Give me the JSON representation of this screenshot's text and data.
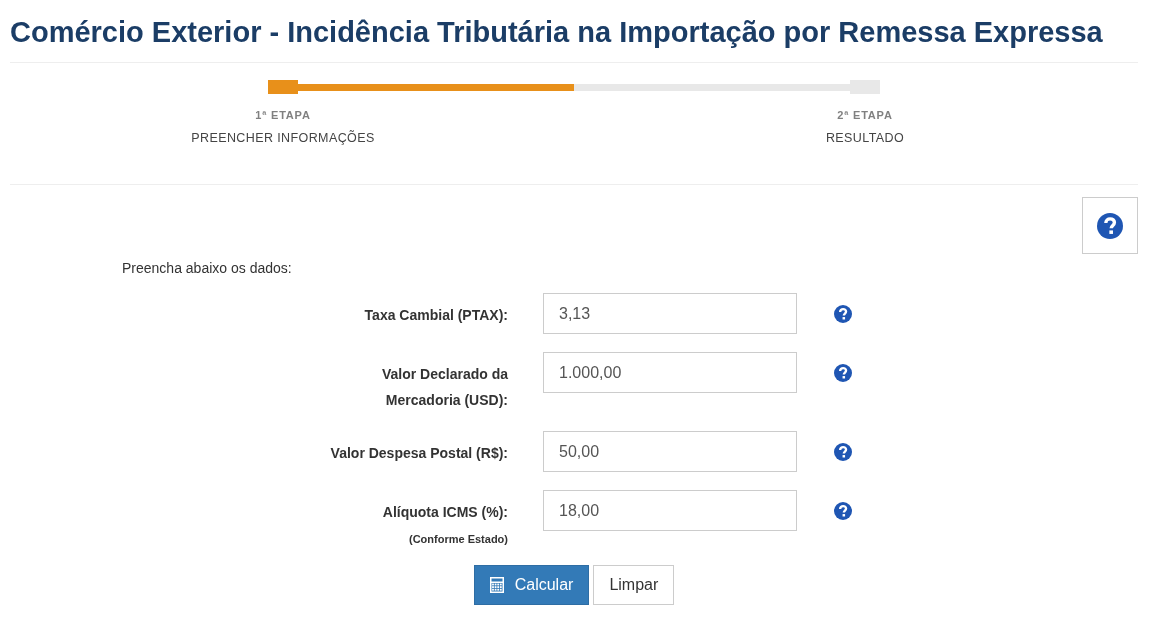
{
  "page": {
    "title": "Comércio Exterior - Incidência Tributária na Importação por Remessa Expressa"
  },
  "stepper": {
    "level": 0.5,
    "steps": [
      {
        "number": "1ª ETAPA",
        "label": "PREENCHER INFORMAÇÕES",
        "selected": true
      },
      {
        "number": "2ª ETAPA",
        "label": "RESULTADO",
        "selected": false
      }
    ]
  },
  "form": {
    "intro": "Preencha abaixo os dados:",
    "fields": [
      {
        "label": "Taxa Cambial (PTAX):",
        "value": "3,13"
      },
      {
        "label": "Valor Declarado da Mercadoria (USD):",
        "value": "1.000,00"
      },
      {
        "label": "Valor Despesa Postal (R$):",
        "value": "50,00"
      },
      {
        "label": "Alíquota ICMS (%):",
        "note": "(Conforme Estado)",
        "value": "18,00"
      }
    ],
    "buttons": [
      {
        "label": "Calcular",
        "kind": "primary"
      },
      {
        "label": "Limpar",
        "kind": "default"
      }
    ]
  }
}
